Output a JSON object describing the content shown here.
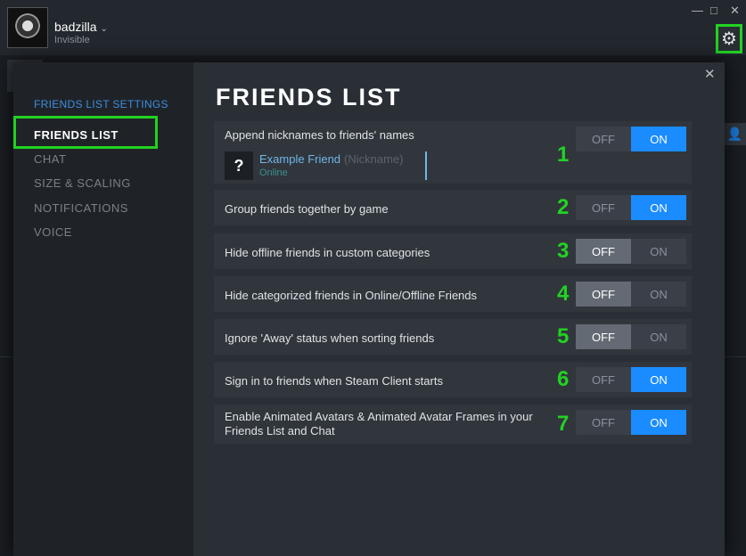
{
  "window": {
    "username": "badzilla",
    "status": "Invisible",
    "minimize_glyph": "—",
    "maximize_glyph": "□",
    "close_glyph": "✕",
    "settings_icon": "gear-icon"
  },
  "dialog": {
    "close_glyph": "✕",
    "sidebar": {
      "title": "FRIENDS LIST SETTINGS",
      "items": [
        {
          "label": "FRIENDS LIST"
        },
        {
          "label": "CHAT"
        },
        {
          "label": "SIZE & SCALING"
        },
        {
          "label": "NOTIFICATIONS"
        },
        {
          "label": "VOICE"
        }
      ]
    },
    "page_title": "FRIENDS LIST",
    "settings": [
      {
        "label": "Append nicknames to friends' names",
        "number": "1",
        "value": "ON"
      },
      {
        "label": "Group friends together by game",
        "number": "2",
        "value": "ON"
      },
      {
        "label": "Hide offline friends in custom categories",
        "number": "3",
        "value": "OFF"
      },
      {
        "label": "Hide categorized friends in Online/Offline Friends",
        "number": "4",
        "value": "OFF"
      },
      {
        "label": "Ignore 'Away' status when sorting friends",
        "number": "5",
        "value": "OFF"
      },
      {
        "label": "Sign in to friends when Steam Client starts",
        "number": "6",
        "value": "ON"
      },
      {
        "label": "Enable Animated Avatars & Animated Avatar Frames in your Friends List and Chat",
        "number": "7",
        "value": "ON"
      }
    ],
    "toggle_labels": {
      "off": "OFF",
      "on": "ON"
    },
    "example_friend": {
      "avatar_glyph": "?",
      "name": "Example Friend",
      "nickname": "(Nickname)",
      "status": "Online"
    }
  },
  "colors": {
    "accent_blue": "#1a8cff",
    "highlight_green": "#21d321"
  }
}
